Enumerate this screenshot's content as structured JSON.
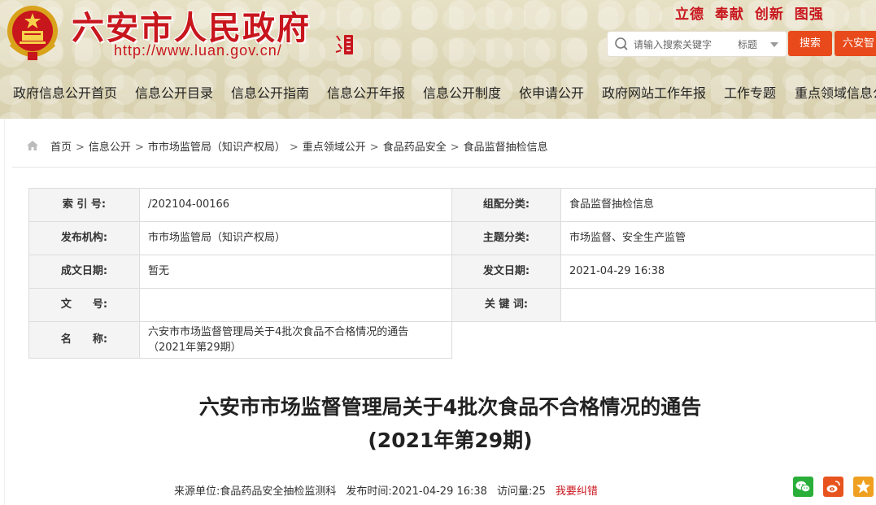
{
  "header": {
    "site_title": "六安市人民政府",
    "site_url": "http://www.luan.gov.cn/",
    "slogan": "立德 奉献 创新 图强",
    "search": {
      "placeholder": "请输入搜索关键字",
      "scope": "标题",
      "button": "搜索",
      "extra_button": "六安智"
    },
    "colors": {
      "brand_red": "#c8161d",
      "search_orange": "#e84a1b"
    }
  },
  "nav": {
    "items": [
      "政府信息公开首页",
      "信息公开目录",
      "信息公开指南",
      "信息公开年报",
      "信息公开制度",
      "依申请公开",
      "政府网站工作年报",
      "工作专题",
      "重点领域信息公"
    ]
  },
  "breadcrumb": {
    "icon": "home-icon",
    "items": [
      "首页",
      "信息公开",
      "市市场监管局（知识产权局）",
      "重点领域公开",
      "食品药品安全",
      "食品监督抽检信息"
    ],
    "separator": ">"
  },
  "meta": {
    "index_label": "索 引 号:",
    "index_value": "/202104-00166",
    "category_label": "组配分类:",
    "category_value": "食品监督抽检信息",
    "org_label": "发布机构:",
    "org_value": "市市场监管局（知识产权局）",
    "topic_label": "主题分类:",
    "topic_value": "市场监督、安全生产监管",
    "created_label": "成文日期:",
    "created_value": "暂无",
    "published_label": "发文日期:",
    "published_value": "2021-04-29 16:38",
    "docno_label": "文　　号:",
    "docno_value": "",
    "keywords_label": "关 键 词:",
    "keywords_value": "",
    "name_label": "名　　称:",
    "name_value_line1": "六安市市场监督管理局关于4批次食品不合格情况的通告",
    "name_value_line2": "（2021年第29期）"
  },
  "article": {
    "title_line1": "六安市市场监督管理局关于4批次食品不合格情况的通告",
    "title_line2": "(2021年第29期)",
    "source_label": "来源单位:",
    "source_value": "食品药品安全抽检监测科",
    "time_label": "发布时间:",
    "time_value": "2021-04-29 16:38",
    "views_label": "访问量:",
    "views_value": "25",
    "correct_link": "我要纠错",
    "share_icons": [
      "wechat-icon",
      "weibo-icon",
      "favorite-star-icon"
    ]
  }
}
